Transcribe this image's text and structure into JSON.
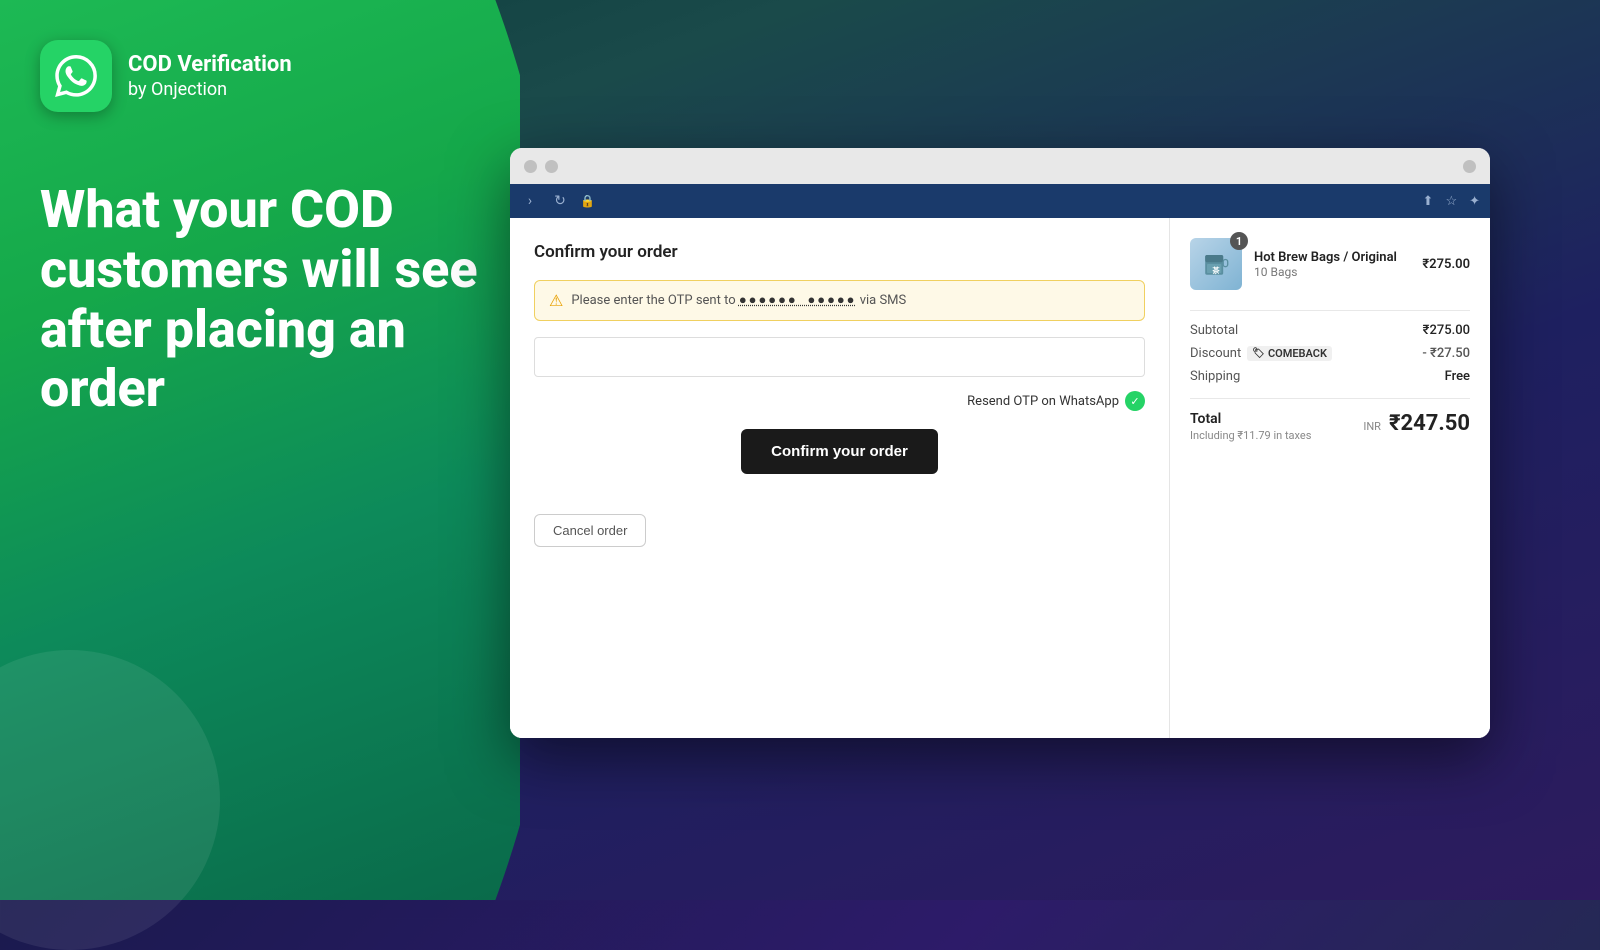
{
  "branding": {
    "app_name": "COD Verification",
    "app_subtitle": "by Onjection"
  },
  "hero": {
    "line1": "What your COD",
    "line2": "customers will see",
    "line3": "after placing an order"
  },
  "browser": {
    "toolbar": {
      "forward_icon": "→",
      "refresh_icon": "↻",
      "lock_icon": "🔒"
    }
  },
  "order_form": {
    "title": "Confirm your order",
    "otp_alert": "Please enter the OTP sent to ●●●●●● ●●●●● via SMS",
    "otp_placeholder": "",
    "resend_label": "Resend OTP on WhatsApp",
    "confirm_button": "Confirm your order",
    "cancel_button": "Cancel order"
  },
  "order_summary": {
    "product": {
      "name": "Hot Brew Bags / Original",
      "variant": "10 Bags",
      "price": "₹275.00",
      "badge": "1"
    },
    "subtotal_label": "Subtotal",
    "subtotal_value": "₹275.00",
    "discount_label": "Discount",
    "discount_code": "COMEBACK",
    "discount_value": "- ₹27.50",
    "shipping_label": "Shipping",
    "shipping_value": "Free",
    "total_label": "Total",
    "total_tax": "Including ₹11.79 in taxes",
    "total_currency": "INR",
    "total_value": "₹247.50"
  },
  "colors": {
    "green_primary": "#25d366",
    "green_dark": "#1db954",
    "navy": "#1a3a6b",
    "dark": "#1a1a1a",
    "alert_bg": "#fef9e7",
    "alert_border": "#f0d060"
  }
}
